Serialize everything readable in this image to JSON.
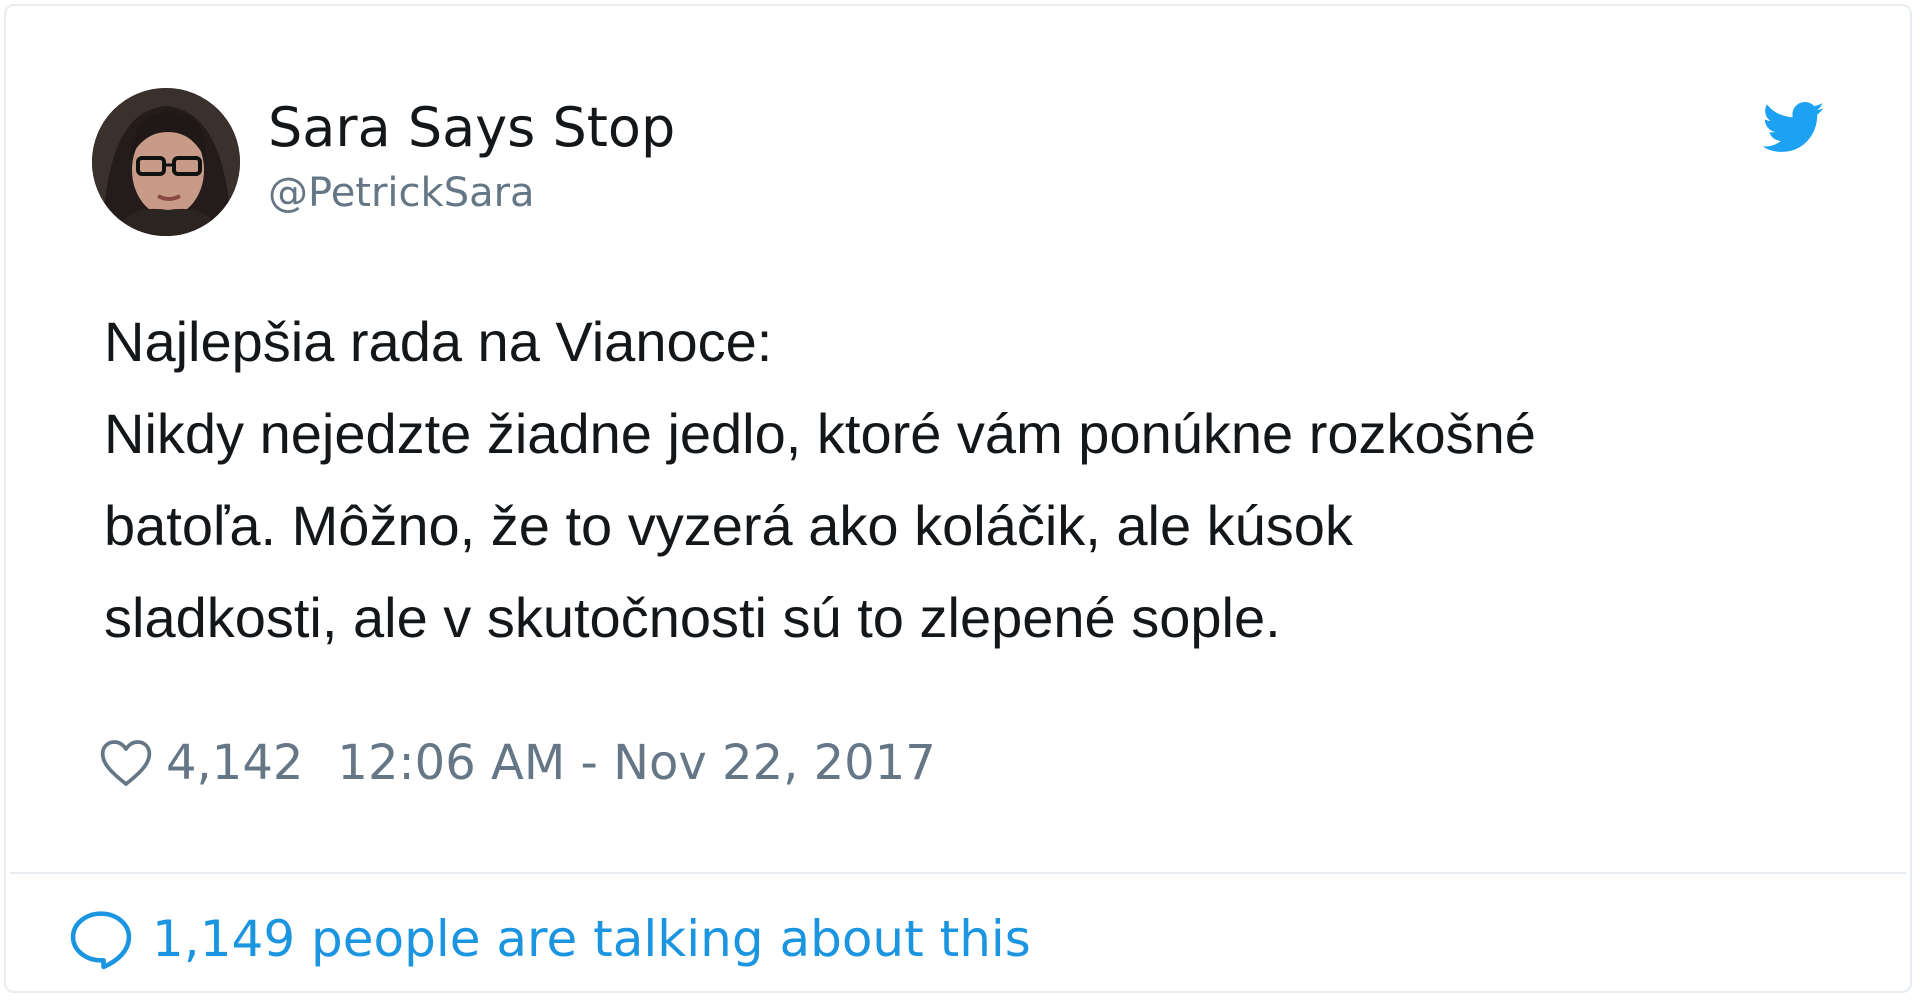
{
  "tweet": {
    "author": {
      "display_name": "Sara Says Stop",
      "handle": "@PetrickSara",
      "avatar_icon": "profile-photo"
    },
    "text_lines": [
      "Najlepšia rada na Vianoce:",
      "Nikdy nejedzte žiadne jedlo, ktoré vám ponúkne rozkošné",
      "batoľa. Môžno, že to vyzerá ako koláčik, ale kúsok",
      "sladkosti, ale v skutočnosti sú to zlepené sople."
    ],
    "likes": "4,142",
    "timestamp": "12:06 AM - Nov 22, 2017",
    "conversation": "1,149 people are talking about this"
  },
  "icons": {
    "brand": "twitter-bird-icon",
    "like": "heart-icon",
    "reply": "speech-bubble-icon"
  },
  "colors": {
    "brand_blue": "#1da1f2",
    "link_blue": "#1b95e0",
    "text_primary": "#14171a",
    "text_secondary": "#657786",
    "border": "#e6ecf0"
  }
}
